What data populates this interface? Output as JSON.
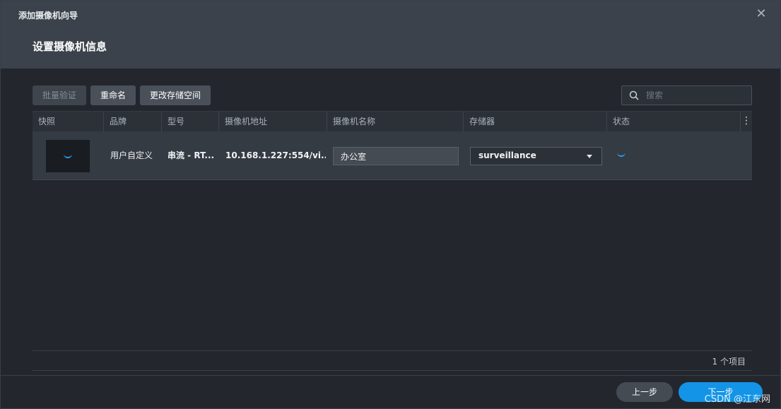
{
  "window": {
    "title": "添加摄像机向导",
    "close_label": "✕"
  },
  "page": {
    "title": "设置摄像机信息"
  },
  "toolbar": {
    "batch_verify_label": "批量验证",
    "rename_label": "重命名",
    "change_storage_label": "更改存储空间"
  },
  "search": {
    "placeholder": "搜索",
    "value": ""
  },
  "table": {
    "columns": [
      "快照",
      "品牌",
      "型号",
      "摄像机地址",
      "摄像机名称",
      "存储器",
      "状态"
    ],
    "menu_label": "⋮",
    "rows": [
      {
        "brand": "用户自定义",
        "model": "串流 - RT...",
        "address": "10.168.1.227:554/vi...",
        "name": "办公室",
        "storage": "surveillance"
      }
    ]
  },
  "footer": {
    "item_count": "1 个项目",
    "prev_label": "上一步",
    "next_label": "下一步",
    "watermark": "CSDN @江东网"
  },
  "colors": {
    "accent": "#1394e6",
    "header_bg": "#3c424b",
    "body_bg": "#23272d"
  }
}
